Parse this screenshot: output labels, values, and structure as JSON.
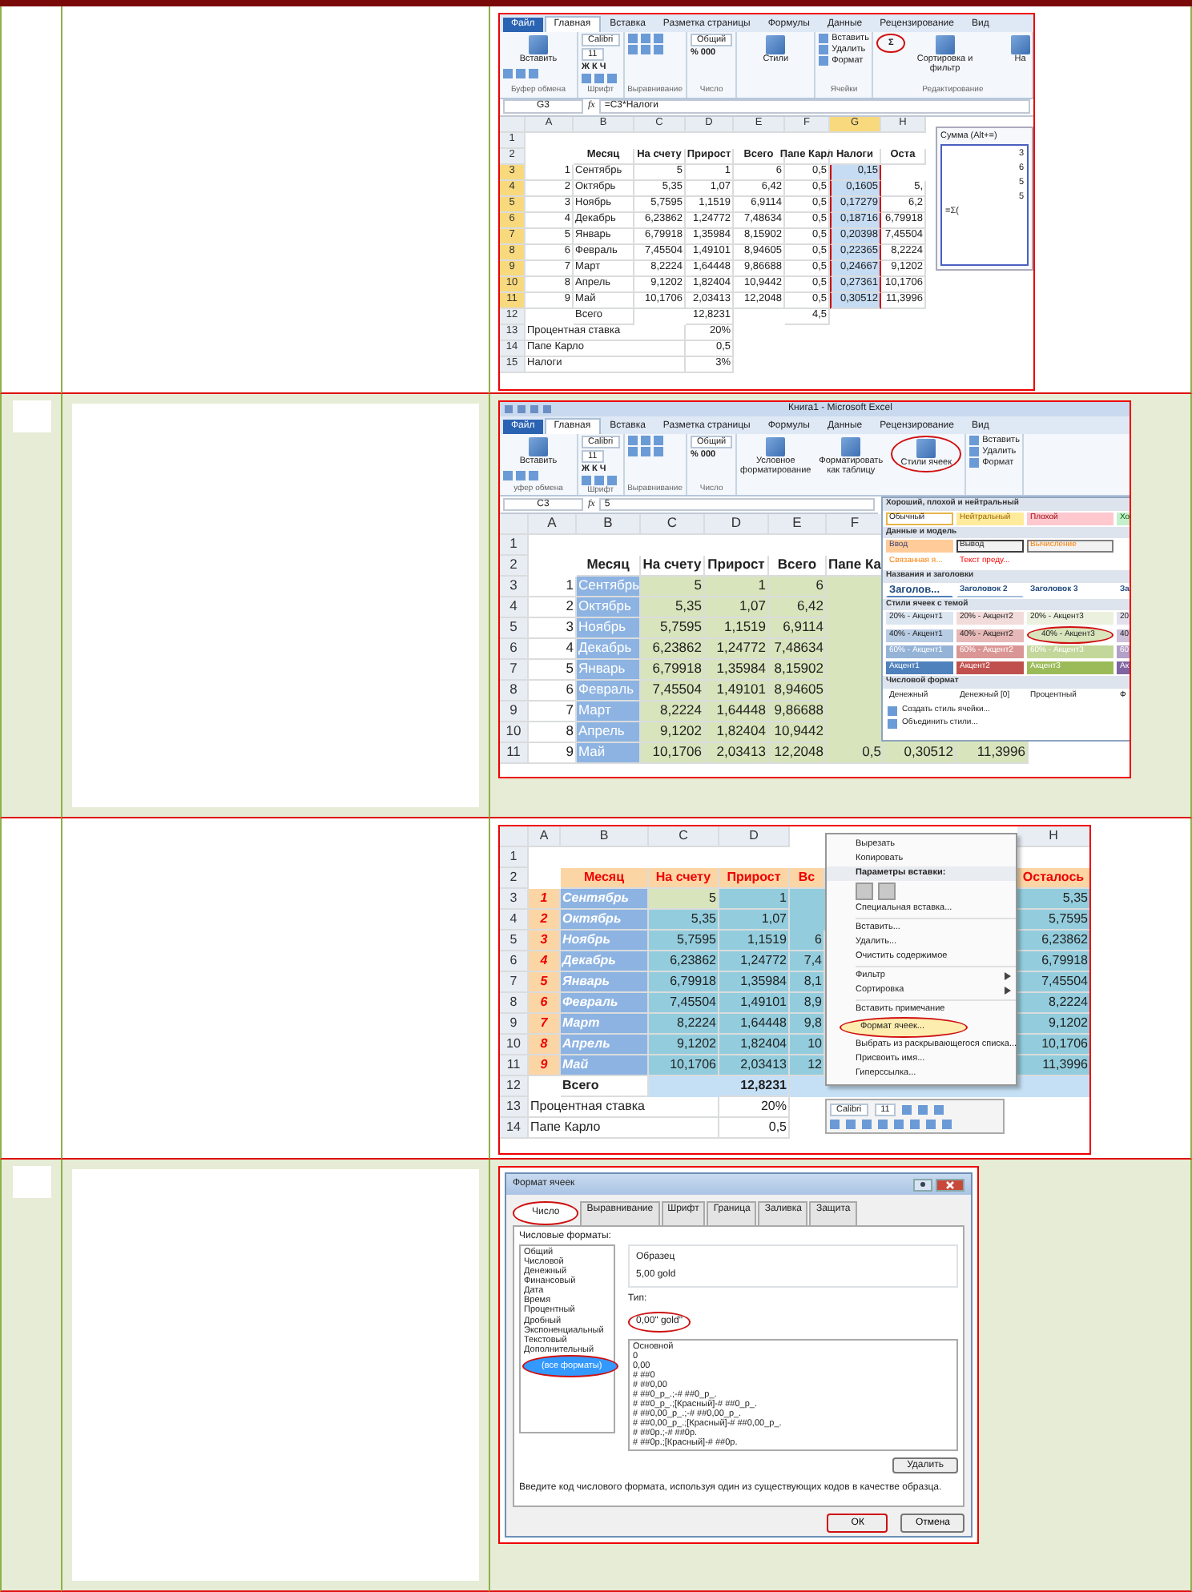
{
  "document_rows": [
    {
      "shaded": false,
      "panel": {
        "kind": "sum_sheet",
        "tabs": [
          {
            "label": "Файл",
            "kind": "file",
            "selected": false
          },
          {
            "label": "Главная",
            "kind": "tab",
            "selected": true
          },
          {
            "label": "Вставка",
            "kind": "tab",
            "selected": false
          },
          {
            "label": "Разметка страницы",
            "kind": "tab",
            "selected": false
          },
          {
            "label": "Формулы",
            "kind": "tab",
            "selected": false
          },
          {
            "label": "Данные",
            "kind": "tab",
            "selected": false
          },
          {
            "label": "Рецензирование",
            "kind": "tab",
            "selected": false
          },
          {
            "label": "Вид",
            "kind": "tab",
            "selected": false
          }
        ],
        "ribbon": [
          {
            "label": "Буфер обмена",
            "items": [
              {
                "kind": "big",
                "label": "Вставить"
              },
              {
                "kind": "icons"
              }
            ]
          },
          {
            "label": "Шрифт",
            "items": [
              {
                "kind": "field",
                "label": "Calibri"
              },
              {
                "kind": "field",
                "label": "11"
              },
              {
                "kind": "glyphs",
                "label": "Ж К Ч"
              },
              {
                "kind": "icons"
              }
            ]
          },
          {
            "label": "Выравнивание",
            "items": [
              {
                "kind": "icons"
              },
              {
                "kind": "icons"
              }
            ]
          },
          {
            "label": "Число",
            "items": [
              {
                "kind": "field",
                "label": "Общий"
              },
              {
                "kind": "glyphs",
                "label": "% 000"
              }
            ]
          },
          {
            "items": [
              {
                "kind": "big",
                "label": "Стили"
              }
            ]
          },
          {
            "label": "Ячейки",
            "items": [
              {
                "kind": "small",
                "label": "Вставить"
              },
              {
                "kind": "small",
                "label": "Удалить"
              },
              {
                "kind": "small",
                "label": "Формат"
              }
            ]
          },
          {
            "label": "Редактирование",
            "items": [
              {
                "kind": "sum",
                "label": "Σ",
                "circled": true
              },
              {
                "kind": "big",
                "label": "Сортировка и фильтр"
              },
              {
                "kind": "big",
                "label": "На"
              }
            ]
          }
        ],
        "formula_bar": {
          "name_box": "G3",
          "function_label": "fx",
          "formula": "=C3*Налоги"
        },
        "grid": {
          "columns": [
            {
              "label": "A",
              "selected": false
            },
            {
              "label": "B",
              "selected": false
            },
            {
              "label": "C",
              "selected": false
            },
            {
              "label": "D",
              "selected": false
            },
            {
              "label": "E",
              "selected": false
            },
            {
              "label": "F",
              "selected": false
            },
            {
              "label": "G",
              "selected": true
            },
            {
              "label": "H",
              "selected": false
            }
          ],
          "rows": [
            {
              "num": "1",
              "kind": "data",
              "selected": false,
              "cells": [
                null,
                null,
                null,
                null,
                null,
                null,
                null,
                null
              ]
            },
            {
              "num": "2",
              "kind": "header",
              "selected": false,
              "cells": [
                null,
                "Месяц",
                "На счету",
                "Прирост",
                "Всего",
                "Папе Карл",
                "Налоги",
                "Оста"
              ]
            },
            {
              "num": "3",
              "kind": "data",
              "selected": true,
              "cells": [
                "1",
                "Сентябрь",
                "5",
                "1",
                "6",
                "0,5",
                "0,15",
                null
              ]
            },
            {
              "num": "4",
              "kind": "data",
              "selected": true,
              "cells": [
                "2",
                "Октябрь",
                "5,35",
                "1,07",
                "6,42",
                "0,5",
                "0,1605",
                "5,"
              ]
            },
            {
              "num": "5",
              "kind": "data",
              "selected": true,
              "cells": [
                "3",
                "Ноябрь",
                "5,7595",
                "1,1519",
                "6,9114",
                "0,5",
                "0,17279",
                "6,2"
              ]
            },
            {
              "num": "6",
              "kind": "data",
              "selected": true,
              "cells": [
                "4",
                "Декабрь",
                "6,23862",
                "1,24772",
                "7,48634",
                "0,5",
                "0,18716",
                "6,79918"
              ]
            },
            {
              "num": "7",
              "kind": "data",
              "selected": true,
              "cells": [
                "5",
                "Январь",
                "6,79918",
                "1,35984",
                "8,15902",
                "0,5",
                "0,20398",
                "7,45504"
              ]
            },
            {
              "num": "8",
              "kind": "data",
              "selected": true,
              "cells": [
                "6",
                "Февраль",
                "7,45504",
                "1,49101",
                "8,94605",
                "0,5",
                "0,22365",
                "8,2224"
              ]
            },
            {
              "num": "9",
              "kind": "data",
              "selected": true,
              "cells": [
                "7",
                "Март",
                "8,2224",
                "1,64448",
                "9,86688",
                "0,5",
                "0,24667",
                "9,1202"
              ]
            },
            {
              "num": "10",
              "kind": "data",
              "selected": true,
              "cells": [
                "8",
                "Апрель",
                "9,1202",
                "1,82404",
                "10,9442",
                "0,5",
                "0,27361",
                "10,1706"
              ]
            },
            {
              "num": "11",
              "kind": "data",
              "selected": true,
              "cells": [
                "9",
                "Май",
                "10,1706",
                "2,03413",
                "12,2048",
                "0,5",
                "0,30512",
                "11,3996"
              ]
            },
            {
              "num": "12",
              "kind": "data",
              "selected": false,
              "cells": [
                null,
                "Всего",
                null,
                "12,8231",
                null,
                "4,5",
                null,
                null
              ]
            },
            {
              "num": "13",
              "kind": "note",
              "selected": false,
              "cells": [
                "Процентная ставка",
                null,
                null,
                "20%",
                null,
                null,
                null,
                null
              ]
            },
            {
              "num": "14",
              "kind": "note",
              "selected": false,
              "cells": [
                "Папе Карло",
                null,
                null,
                "0,5",
                null,
                null,
                null,
                null
              ]
            },
            {
              "num": "15",
              "kind": "note",
              "selected": false,
              "cells": [
                "Налоги",
                null,
                null,
                "3%",
                null,
                null,
                null,
                null
              ]
            }
          ]
        },
        "tooltip": {
          "title": "Сумма (Alt+=)",
          "preview": [
            "3",
            "6",
            "5",
            "5"
          ],
          "formula": "=Σ("
        }
      }
    },
    {
      "shaded": true,
      "panel": {
        "kind": "styles_sheet",
        "title": "Книга1 - Microsoft Excel",
        "tabs": [
          {
            "label": "Файл",
            "kind": "file",
            "selected": false
          },
          {
            "label": "Главная",
            "kind": "tab",
            "selected": true
          },
          {
            "label": "Вставка",
            "kind": "tab",
            "selected": false
          },
          {
            "label": "Разметка страницы",
            "kind": "tab",
            "selected": false
          },
          {
            "label": "Формулы",
            "kind": "tab",
            "selected": false
          },
          {
            "label": "Данные",
            "kind": "tab",
            "selected": false
          },
          {
            "label": "Рецензирование",
            "kind": "tab",
            "selected": false
          },
          {
            "label": "Вид",
            "kind": "tab",
            "selected": false
          }
        ],
        "ribbon": [
          {
            "label": "уфер обмена",
            "items": [
              {
                "kind": "big",
                "label": "Вставить"
              },
              {
                "kind": "icons"
              }
            ]
          },
          {
            "label": "Шрифт",
            "items": [
              {
                "kind": "field",
                "label": "Calibri"
              },
              {
                "kind": "field",
                "label": "11"
              },
              {
                "kind": "glyphs",
                "label": "Ж К Ч"
              },
              {
                "kind": "icons"
              }
            ]
          },
          {
            "label": "Выравнивание",
            "items": [
              {
                "kind": "icons"
              },
              {
                "kind": "icons"
              }
            ]
          },
          {
            "label": "Число",
            "items": [
              {
                "kind": "field",
                "label": "Общий"
              },
              {
                "kind": "glyphs",
                "label": "% 000"
              }
            ]
          },
          {
            "items": [
              {
                "kind": "big",
                "label": "Условное форматирование"
              },
              {
                "kind": "big",
                "label": "Форматировать как таблицу"
              },
              {
                "kind": "big",
                "label": "Стили ячеек",
                "circled": true
              }
            ]
          },
          {
            "items": [
              {
                "kind": "small",
                "label": "Вставить"
              },
              {
                "kind": "small",
                "label": "Удалить"
              },
              {
                "kind": "small",
                "label": "Формат"
              }
            ]
          }
        ],
        "formula_bar": {
          "name_box": "C3",
          "function_label": "fx",
          "formula": "5"
        },
        "grid": {
          "columns": [
            {
              "label": "A"
            },
            {
              "label": "B"
            },
            {
              "label": "C"
            },
            {
              "label": "D"
            },
            {
              "label": "E"
            },
            {
              "label": "F"
            }
          ],
          "rows": [
            {
              "num": "1",
              "kind": "data",
              "cells": [
                null,
                null,
                null,
                null,
                null,
                null,
                null,
                null
              ]
            },
            {
              "num": "2",
              "kind": "header",
              "cells": [
                null,
                "Месяц",
                "На счету",
                "Прирост",
                "Всего",
                "Папе Ка",
                null,
                null
              ]
            },
            {
              "num": "3",
              "kind": "data",
              "cells": [
                "1",
                "Сентябрь",
                "5",
                "1",
                "6",
                null,
                null,
                null
              ]
            },
            {
              "num": "4",
              "kind": "data",
              "cells": [
                "2",
                "Октябрь",
                "5,35",
                "1,07",
                "6,42",
                null,
                null,
                null
              ]
            },
            {
              "num": "5",
              "kind": "data",
              "cells": [
                "3",
                "Ноябрь",
                "5,7595",
                "1,1519",
                "6,9114",
                null,
                null,
                null
              ]
            },
            {
              "num": "6",
              "kind": "data",
              "cells": [
                "4",
                "Декабрь",
                "6,23862",
                "1,24772",
                "7,48634",
                null,
                null,
                null
              ]
            },
            {
              "num": "7",
              "kind": "data",
              "cells": [
                "5",
                "Январь",
                "6,79918",
                "1,35984",
                "8,15902",
                null,
                null,
                null
              ]
            },
            {
              "num": "8",
              "kind": "data",
              "cells": [
                "6",
                "Февраль",
                "7,45504",
                "1,49101",
                "8,94605",
                null,
                null,
                null
              ]
            },
            {
              "num": "9",
              "kind": "data",
              "cells": [
                "7",
                "Март",
                "8,2224",
                "1,64448",
                "9,86688",
                null,
                null,
                null
              ]
            },
            {
              "num": "10",
              "kind": "data",
              "cells": [
                "8",
                "Апрель",
                "9,1202",
                "1,82404",
                "10,9442",
                null,
                null,
                null
              ]
            },
            {
              "num": "11",
              "kind": "data",
              "cells": [
                "9",
                "Май",
                "10,1706",
                "2,03413",
                "12,2048",
                "0,5",
                "0,30512",
                "11,3996"
              ]
            }
          ]
        },
        "gallery": {
          "sections": [
            {
              "title": "Хороший, плохой и нейтральный",
              "rows": [
                [
                  {
                    "label": "Обычный",
                    "kind": "normal"
                  },
                  {
                    "label": "Нейтральный",
                    "kind": "neutral"
                  },
                  {
                    "label": "Плохой",
                    "kind": "bad"
                  },
                  {
                    "label": "Хо",
                    "kind": "good"
                  }
                ]
              ]
            },
            {
              "title": "Данные и модель",
              "rows": [
                [
                  {
                    "label": "Ввод",
                    "kind": "input"
                  },
                  {
                    "label": "Вывод",
                    "kind": "output"
                  },
                  {
                    "label": "Вычисление",
                    "kind": "calc"
                  }
                ],
                [
                  {
                    "label": "Связанная я...",
                    "kind": "linked"
                  },
                  {
                    "label": "Текст преду...",
                    "kind": "warn"
                  }
                ]
              ]
            },
            {
              "title": "Названия и заголовки",
              "rows": [
                [
                  {
                    "label": "Заголов...",
                    "kind": "h1"
                  },
                  {
                    "label": "Заголовок 2",
                    "kind": "h2"
                  },
                  {
                    "label": "Заголовок 3",
                    "kind": "h3"
                  },
                  {
                    "label": "За",
                    "kind": "h4"
                  }
                ]
              ]
            },
            {
              "title": "Стили ячеек с темой",
              "rows": [
                [
                  {
                    "label": "20% - Акцент1",
                    "kind": "a20_1"
                  },
                  {
                    "label": "20% - Акцент2",
                    "kind": "a20_2"
                  },
                  {
                    "label": "20% - Акцент3",
                    "kind": "a20_3"
                  },
                  {
                    "label": "20",
                    "kind": "a20_4"
                  }
                ],
                [
                  {
                    "label": "40% - Акцент1",
                    "kind": "a40_1"
                  },
                  {
                    "label": "40% - Акцент2",
                    "kind": "a40_2"
                  },
                  {
                    "label": "40% - Акцент3",
                    "kind": "a40_3",
                    "circled": true
                  },
                  {
                    "label": "40",
                    "kind": "a40_4"
                  }
                ],
                [
                  {
                    "label": "60% - Акцент1",
                    "kind": "a60_1"
                  },
                  {
                    "label": "60% - Акцент2",
                    "kind": "a60_2"
                  },
                  {
                    "label": "60% - Акцент3",
                    "kind": "a60_3"
                  },
                  {
                    "label": "60",
                    "kind": "a60_4"
                  }
                ],
                [
                  {
                    "label": "Акцент1",
                    "kind": "acc_1"
                  },
                  {
                    "label": "Акцент2",
                    "kind": "acc_2"
                  },
                  {
                    "label": "Акцент3",
                    "kind": "acc_3"
                  },
                  {
                    "label": "Ак",
                    "kind": "acc_4"
                  }
                ]
              ]
            },
            {
              "title": "Числовой формат",
              "rows": [
                [
                  {
                    "label": "Денежный",
                    "kind": "num"
                  },
                  {
                    "label": "Денежный [0]",
                    "kind": "num"
                  },
                  {
                    "label": "Процентный",
                    "kind": "num"
                  },
                  {
                    "label": "Ф",
                    "kind": "num"
                  }
                ]
              ]
            }
          ],
          "commands": [
            "Создать стиль ячейки...",
            "Объединить стили..."
          ]
        }
      }
    },
    {
      "shaded": false,
      "panel": {
        "kind": "context_sheet",
        "grid": {
          "columns": [
            {
              "label": "A"
            },
            {
              "label": "B"
            },
            {
              "label": "C"
            },
            {
              "label": "D"
            },
            null,
            null,
            null,
            {
              "label": "H"
            }
          ],
          "rows": [
            {
              "num": "1",
              "kind": "data",
              "cells": [
                null,
                null,
                null,
                null,
                null,
                null,
                null,
                null
              ]
            },
            {
              "num": "2",
              "kind": "header",
              "cells": [
                null,
                "Месяц",
                "На счету",
                "Прирост",
                "Вс",
                null,
                null,
                "Осталось"
              ]
            },
            {
              "num": "3",
              "kind": "data",
              "cells": [
                "1",
                "Сентябрь",
                "5",
                "1",
                null,
                null,
                null,
                "5,35"
              ]
            },
            {
              "num": "4",
              "kind": "data",
              "cells": [
                "2",
                "Октябрь",
                "5,35",
                "1,07",
                null,
                null,
                null,
                "5,7595"
              ]
            },
            {
              "num": "5",
              "kind": "data",
              "cells": [
                "3",
                "Ноябрь",
                "5,7595",
                "1,1519",
                "6",
                null,
                null,
                "6,23862"
              ]
            },
            {
              "num": "6",
              "kind": "data",
              "cells": [
                "4",
                "Декабрь",
                "6,23862",
                "1,24772",
                "7,4",
                null,
                null,
                "6,79918"
              ]
            },
            {
              "num": "7",
              "kind": "data",
              "cells": [
                "5",
                "Январь",
                "6,79918",
                "1,35984",
                "8,1",
                null,
                null,
                "7,45504"
              ]
            },
            {
              "num": "8",
              "kind": "data",
              "cells": [
                "6",
                "Февраль",
                "7,45504",
                "1,49101",
                "8,9",
                null,
                null,
                "8,2224"
              ]
            },
            {
              "num": "9",
              "kind": "data",
              "cells": [
                "7",
                "Март",
                "8,2224",
                "1,64448",
                "9,8",
                null,
                null,
                "9,1202"
              ]
            },
            {
              "num": "10",
              "kind": "data",
              "cells": [
                "8",
                "Апрель",
                "9,1202",
                "1,82404",
                "10",
                null,
                null,
                "10,1706"
              ]
            },
            {
              "num": "11",
              "kind": "data",
              "cells": [
                "9",
                "Май",
                "10,1706",
                "2,03413",
                "12",
                null,
                null,
                "11,3996"
              ]
            },
            {
              "num": "12",
              "kind": "total",
              "cells": [
                null,
                "Всего",
                null,
                "12,8231",
                null,
                null,
                null,
                null
              ]
            },
            {
              "num": "13",
              "kind": "note",
              "cells": [
                "Процентная ставка",
                null,
                null,
                "20%",
                null,
                null,
                null,
                null
              ]
            },
            {
              "num": "14",
              "kind": "note",
              "cells": [
                "Папе Карло",
                null,
                null,
                "0,5",
                null,
                null,
                null,
                null
              ]
            }
          ]
        },
        "menu": [
          {
            "kind": "item",
            "label": "Вырезать",
            "selected": false
          },
          {
            "kind": "item",
            "label": "Копировать",
            "selected": false
          },
          {
            "kind": "heading",
            "label": "Параметры вставки:"
          },
          {
            "kind": "paste_icons"
          },
          {
            "kind": "item",
            "label": "Специальная вставка...",
            "selected": false
          },
          {
            "kind": "separator"
          },
          {
            "kind": "item",
            "label": "Вставить...",
            "selected": false
          },
          {
            "kind": "item",
            "label": "Удалить...",
            "selected": false
          },
          {
            "kind": "item",
            "label": "Очистить содержимое",
            "selected": false
          },
          {
            "kind": "separator"
          },
          {
            "kind": "submenu",
            "label": "Фильтр",
            "selected": false
          },
          {
            "kind": "submenu",
            "label": "Сортировка",
            "selected": false
          },
          {
            "kind": "separator"
          },
          {
            "kind": "item",
            "label": "Вставить примечание",
            "selected": false
          },
          {
            "kind": "item",
            "label": "Формат ячеек...",
            "selected": true,
            "circled": true
          },
          {
            "kind": "item",
            "label": "Выбрать из раскрывающегося списка...",
            "selected": false
          },
          {
            "kind": "item",
            "label": "Присвоить имя...",
            "selected": false
          },
          {
            "kind": "item",
            "label": "Гиперссылка...",
            "selected": false
          }
        ],
        "mini_toolbar": {
          "font": "Calibri",
          "size": "11"
        }
      }
    },
    {
      "shaded": true,
      "panel": {
        "kind": "format_dialog",
        "title": "Формат ячеек",
        "tabs": [
          {
            "label": "Число",
            "selected": true,
            "circled": true
          },
          {
            "label": "Выравнивание",
            "selected": false
          },
          {
            "label": "Шрифт",
            "selected": false
          },
          {
            "label": "Граница",
            "selected": false
          },
          {
            "label": "Заливка",
            "selected": false
          },
          {
            "label": "Защита",
            "selected": false
          }
        ],
        "categories_label": "Числовые форматы:",
        "categories": [
          {
            "label": "Общий",
            "selected": false
          },
          {
            "label": "Числовой",
            "selected": false
          },
          {
            "label": "Денежный",
            "selected": false
          },
          {
            "label": "Финансовый",
            "selected": false
          },
          {
            "label": "Дата",
            "selected": false
          },
          {
            "label": "Время",
            "selected": false
          },
          {
            "label": "Процентный",
            "selected": false
          },
          {
            "label": "Дробный",
            "selected": false
          },
          {
            "label": "Экспоненциальный",
            "selected": false
          },
          {
            "label": "Текстовый",
            "selected": false
          },
          {
            "label": "Дополнительный",
            "selected": false
          },
          {
            "label": "(все форматы)",
            "selected": true,
            "circled": true
          }
        ],
        "sample_label": "Образец",
        "sample": "5,00 gold",
        "type_label": "Тип:",
        "type_value": "0,00\" gold\"",
        "type_circled": true,
        "formats": [
          "Основной",
          "0",
          "0,00",
          "# ##0",
          "# ##0,00",
          "# ##0_р_.;-# ##0_р_.",
          "# ##0_р_.;[Красный]-# ##0_р_.",
          "# ##0,00_р_.;-# ##0,00_р_.",
          "# ##0,00_р_.;[Красный]-# ##0,00_р_.",
          "# ##0р.;-# ##0р.",
          "# ##0р.;[Красный]-# ##0р."
        ],
        "delete_button": "Удалить",
        "hint": "Введите код числового формата, используя один из существующих кодов в качестве образца.",
        "buttons": [
          {
            "label": "ОК",
            "circled": true
          },
          {
            "label": "Отмена",
            "circled": false
          }
        ]
      }
    }
  ]
}
